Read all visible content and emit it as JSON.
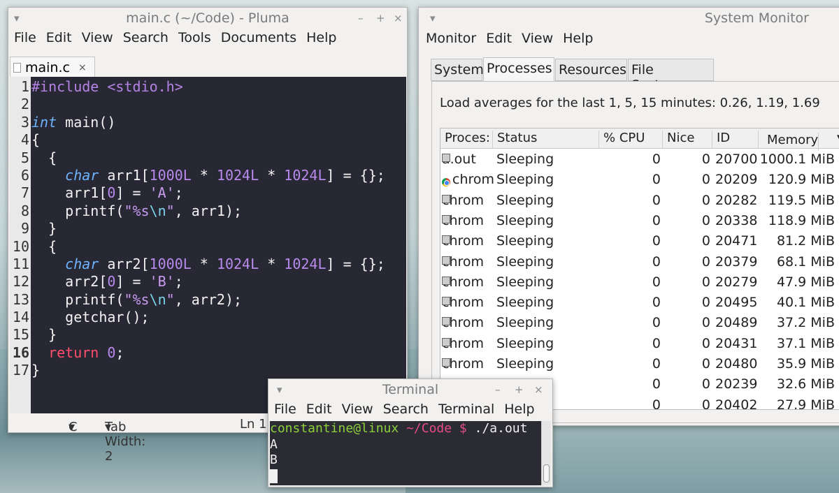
{
  "pluma": {
    "title": "main.c (~/Code) - Pluma",
    "menu": [
      "File",
      "Edit",
      "View",
      "Search",
      "Tools",
      "Documents",
      "Help"
    ],
    "tab_label": "main.c",
    "tab_close": "×",
    "line_numbers": [
      "1",
      "2",
      "3",
      "4",
      "5",
      "6",
      "7",
      "8",
      "9",
      "10",
      "11",
      "12",
      "13",
      "14",
      "15",
      "16",
      "17"
    ],
    "current_line": 16,
    "status": {
      "language": "C",
      "tab_width": "Tab Width: 2",
      "position": "Ln 1"
    }
  },
  "sysmon": {
    "title": "System Monitor",
    "menu": [
      "Monitor",
      "Edit",
      "View",
      "Help"
    ],
    "tabs": [
      "System",
      "Processes",
      "Resources",
      "File Systems"
    ],
    "active_tab": "Processes",
    "load_averages": "Load averages for the last 1, 5, 15 minutes: 0.26, 1.19, 1.69",
    "columns": [
      "Proces:",
      "Status",
      "% CPU",
      "Nice",
      "ID",
      "Memory"
    ],
    "sort_indicator": "▾",
    "processes": [
      {
        "name": "a.out",
        "icon": "generic",
        "status": "Sleeping",
        "cpu": "0",
        "nice": "0",
        "id": "20700",
        "memory": "1000.1 MiB"
      },
      {
        "name": "chrom",
        "icon": "chrome",
        "status": "Sleeping",
        "cpu": "0",
        "nice": "0",
        "id": "20209",
        "memory": "120.9 MiB"
      },
      {
        "name": "chrom",
        "icon": "generic",
        "status": "Sleeping",
        "cpu": "0",
        "nice": "0",
        "id": "20282",
        "memory": "119.5 MiB"
      },
      {
        "name": "chrom",
        "icon": "generic",
        "status": "Sleeping",
        "cpu": "0",
        "nice": "0",
        "id": "20338",
        "memory": "118.9 MiB"
      },
      {
        "name": "chrom",
        "icon": "generic",
        "status": "Sleeping",
        "cpu": "0",
        "nice": "0",
        "id": "20471",
        "memory": "81.2 MiB"
      },
      {
        "name": "chrom",
        "icon": "generic",
        "status": "Sleeping",
        "cpu": "0",
        "nice": "0",
        "id": "20379",
        "memory": "68.1 MiB"
      },
      {
        "name": "chrom",
        "icon": "generic",
        "status": "Sleeping",
        "cpu": "0",
        "nice": "0",
        "id": "20279",
        "memory": "47.9 MiB"
      },
      {
        "name": "chrom",
        "icon": "generic",
        "status": "Sleeping",
        "cpu": "0",
        "nice": "0",
        "id": "20495",
        "memory": "40.1 MiB"
      },
      {
        "name": "chrom",
        "icon": "generic",
        "status": "Sleeping",
        "cpu": "0",
        "nice": "0",
        "id": "20489",
        "memory": "37.2 MiB"
      },
      {
        "name": "chrom",
        "icon": "generic",
        "status": "Sleeping",
        "cpu": "0",
        "nice": "0",
        "id": "20431",
        "memory": "37.1 MiB"
      },
      {
        "name": "chrom",
        "icon": "generic",
        "status": "Sleeping",
        "cpu": "0",
        "nice": "0",
        "id": "20480",
        "memory": "35.9 MiB"
      },
      {
        "name": "",
        "icon": "",
        "status": "",
        "cpu": "0",
        "nice": "0",
        "id": "20239",
        "memory": "32.6 MiB"
      },
      {
        "name": "",
        "icon": "",
        "status": "",
        "cpu": "0",
        "nice": "0",
        "id": "20402",
        "memory": "27.9 MiB"
      }
    ]
  },
  "terminal": {
    "title": "Terminal",
    "menu": [
      "File",
      "Edit",
      "View",
      "Search",
      "Terminal",
      "Help"
    ],
    "prompt_user": "constantine@linux",
    "prompt_path": "~/Code $",
    "command": "./a.out",
    "output": [
      "A",
      "B"
    ]
  },
  "window_controls": {
    "menu": "▾",
    "minimize": "–",
    "maximize": "+",
    "close": "×"
  }
}
